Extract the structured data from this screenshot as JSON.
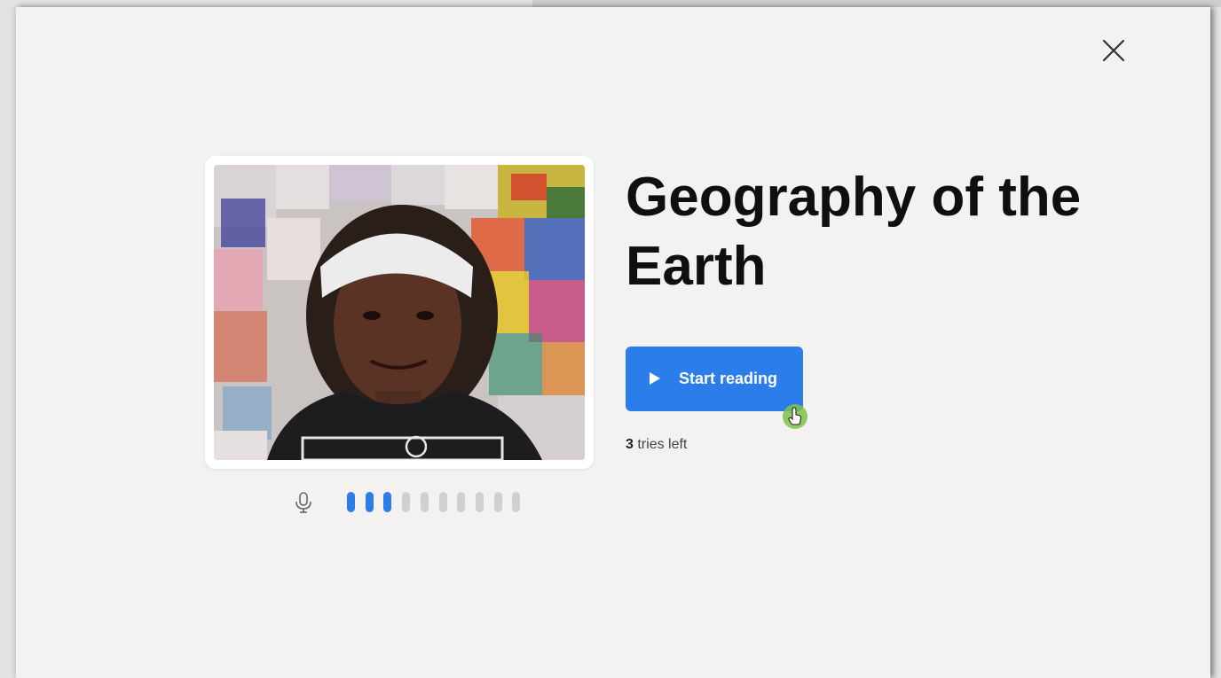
{
  "dialog": {
    "title": "Geography of the Earth",
    "start_button_label": "Start reading",
    "tries_count": "3",
    "tries_label": "tries left"
  },
  "mic_level": {
    "active_bars": 3,
    "total_bars": 10,
    "active_color": "#2b7de9",
    "inactive_color": "#d0d0d0"
  },
  "colors": {
    "accent": "#2b7de9",
    "cursor_highlight": "#7dc24b",
    "dialog_background": "#f3f2f1"
  },
  "icons": {
    "close": "close-icon",
    "play": "play-icon",
    "mic": "microphone-icon",
    "cursor": "hand-pointer-icon"
  }
}
